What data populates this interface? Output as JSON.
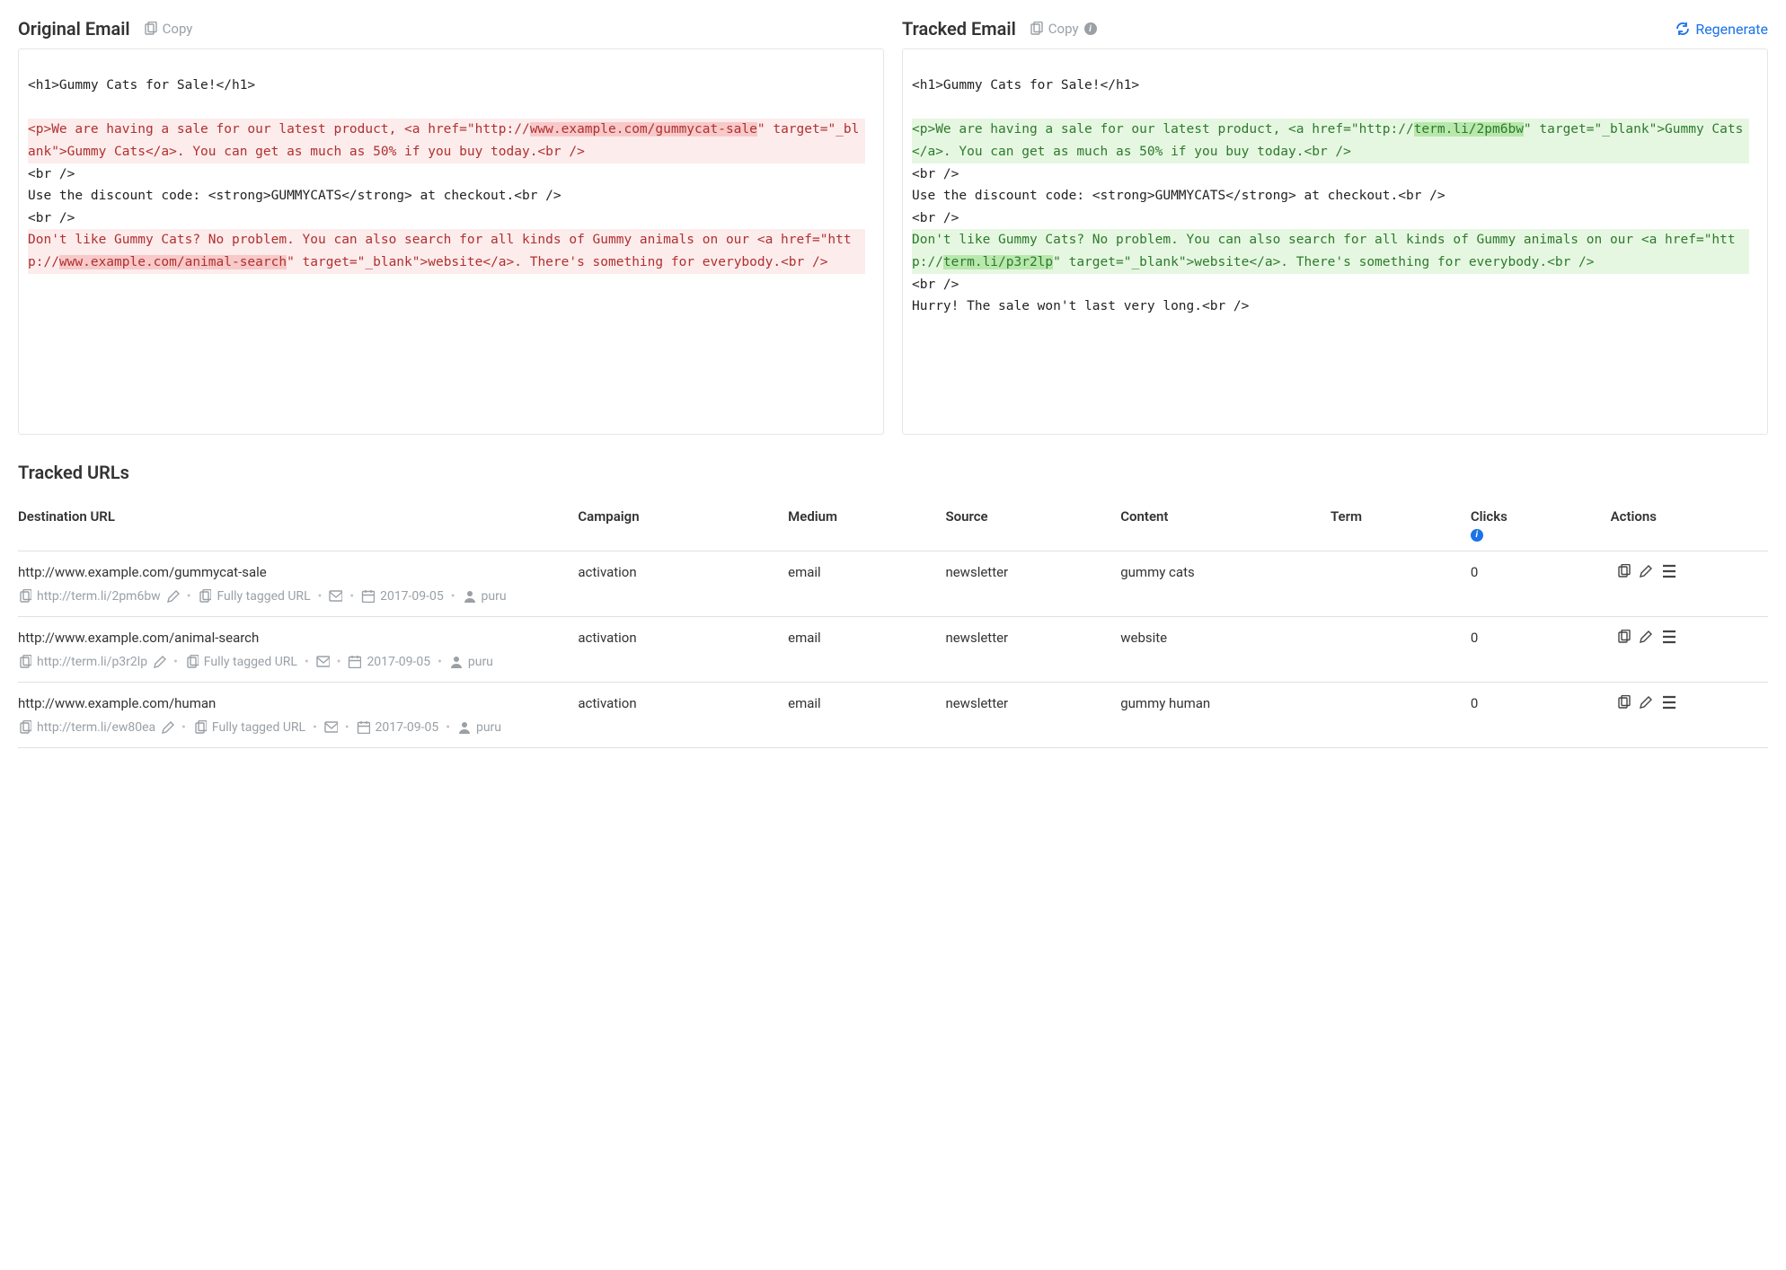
{
  "panels": {
    "original": {
      "title": "Original Email",
      "copy_label": "Copy"
    },
    "tracked": {
      "title": "Tracked Email",
      "copy_label": "Copy",
      "regenerate_label": "Regenerate"
    }
  },
  "code": {
    "line_h1": "<h1>Gummy Cats for Sale!</h1>",
    "orig_p1_a": "<p>We are having a sale for our latest product, <a href=\"http://",
    "orig_p1_url": "www.example.com/gummycat-sale",
    "orig_p1_b": "\" target=\"_blank\">Gummy Cats</a>. You can get as much as 50% if you buy today.<br />",
    "br": "<br />",
    "discount": "Use the discount code: <strong>GUMMYCATS</strong> at checkout.<br />",
    "orig_p2_a": "Don't like Gummy Cats? No problem. You can also search for all kinds of Gummy animals on our <a href=\"http://",
    "orig_p2_url": "www.example.com/animal-search",
    "orig_p2_b": "\" target=\"_blank\">website</a>. There's something for everybody.<br />",
    "trk_p1_a": "<p>We are having a sale for our latest product, <a href=\"http://",
    "trk_p1_url": "term.li/2pm6bw",
    "trk_p1_b": "\" target=\"_blank\">Gummy Cats</a>. You can get as much as 50% if you buy today.<br />",
    "trk_p2_a": "Don't like Gummy Cats? No problem. You can also search for all kinds of Gummy animals on our <a href=\"http://",
    "trk_p2_url": "term.li/p3r2lp",
    "trk_p2_b": "\" target=\"_blank\">website</a>. There's something for everybody.<br />",
    "hurry": "Hurry! The sale won't last very long.<br />"
  },
  "tracked_section_title": "Tracked URLs",
  "headers": {
    "dest": "Destination URL",
    "campaign": "Campaign",
    "medium": "Medium",
    "source": "Source",
    "content": "Content",
    "term": "Term",
    "clicks": "Clicks",
    "actions": "Actions"
  },
  "rows": [
    {
      "dest": "http://www.example.com/gummycat-sale",
      "campaign": "activation",
      "medium": "email",
      "source": "newsletter",
      "content": "gummy cats",
      "term": "",
      "clicks": "0",
      "short": "http://term.li/2pm6bw",
      "tagged": "Fully tagged URL",
      "date": "2017-09-05",
      "user": "puru"
    },
    {
      "dest": "http://www.example.com/animal-search",
      "campaign": "activation",
      "medium": "email",
      "source": "newsletter",
      "content": "website",
      "term": "",
      "clicks": "0",
      "short": "http://term.li/p3r2lp",
      "tagged": "Fully tagged URL",
      "date": "2017-09-05",
      "user": "puru"
    },
    {
      "dest": "http://www.example.com/human",
      "campaign": "activation",
      "medium": "email",
      "source": "newsletter",
      "content": "gummy human",
      "term": "",
      "clicks": "0",
      "short": "http://term.li/ew80ea",
      "tagged": "Fully tagged URL",
      "date": "2017-09-05",
      "user": "puru"
    }
  ]
}
